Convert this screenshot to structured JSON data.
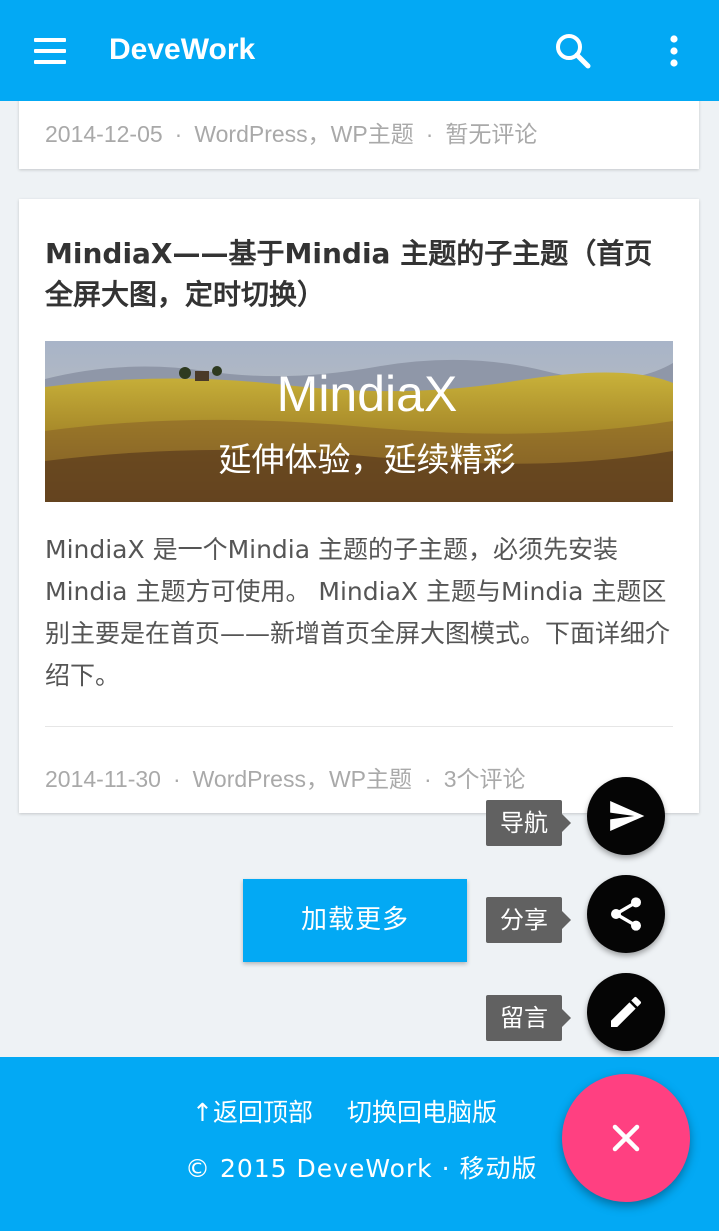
{
  "app": {
    "title": "DeveWork"
  },
  "colors": {
    "primary": "#03a9f4",
    "accent": "#ff4081",
    "fab_mini": "#050505",
    "tooltip": "#616161"
  },
  "toolbar": {
    "menu_icon": "menu-icon",
    "search_icon": "search-icon",
    "more_icon": "more-vert-icon"
  },
  "posts": [
    {
      "date": "2014-12-05",
      "categories": [
        "WordPress",
        "WP主题"
      ],
      "comments": "暂无评论"
    },
    {
      "title": "MindiaX——基于Mindia 主题的子主题（首页全屏大图，定时切换）",
      "image_text": {
        "main": "MindiaX",
        "sub": "延伸体验，延续精彩"
      },
      "excerpt": "MindiaX 是一个Mindia 主题的子主题，必须先安装Mindia 主题方可使用。 MindiaX 主题与Mindia 主题区别主要是在首页——新增首页全屏大图模式。下面详细介绍下。",
      "date": "2014-11-30",
      "categories": [
        "WordPress",
        "WP主题"
      ],
      "comments": "3个评论"
    }
  ],
  "meta_separator": "·",
  "category_separator": "，",
  "load_more": "加载更多",
  "fab_menu": {
    "items": [
      {
        "label": "导航",
        "icon": "send-icon"
      },
      {
        "label": "分享",
        "icon": "share-icon"
      },
      {
        "label": "留言",
        "icon": "edit-icon"
      }
    ],
    "main_icon": "close-icon"
  },
  "footer": {
    "back_to_top": "↑返回顶部",
    "switch_desktop": "切换回电脑版",
    "copyright": "© 2015 DeveWork",
    "dot": "·",
    "mobile": "移动版"
  }
}
